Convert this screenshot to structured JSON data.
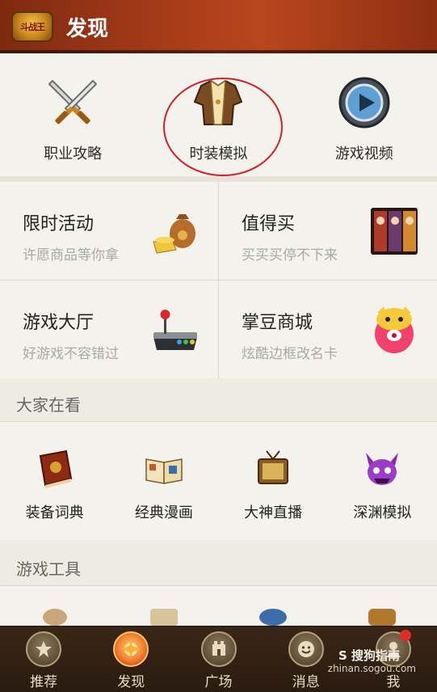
{
  "header": {
    "logo_text": "斗战王",
    "title": "发现"
  },
  "top_row": [
    {
      "label": "职业攻略",
      "icon": "crossed-swords-icon"
    },
    {
      "label": "时装模拟",
      "icon": "costume-icon"
    },
    {
      "label": "游戏视频",
      "icon": "play-icon"
    }
  ],
  "cards": [
    {
      "title": "限时活动",
      "sub": "许愿商品等你拿",
      "icon": "treasure-bag-icon"
    },
    {
      "title": "值得买",
      "sub": "买买买停不下来",
      "icon": "poster-icon"
    },
    {
      "title": "游戏大厅",
      "sub": "好游戏不容错过",
      "icon": "joystick-icon"
    },
    {
      "title": "掌豆商城",
      "sub": "炫酷边框改名卡",
      "icon": "mascot-icon"
    }
  ],
  "section1": {
    "title": "大家在看",
    "items": [
      {
        "label": "装备词典",
        "icon": "book-icon"
      },
      {
        "label": "经典漫画",
        "icon": "comic-icon"
      },
      {
        "label": "大神直播",
        "icon": "tv-icon"
      },
      {
        "label": "深渊模拟",
        "icon": "demon-icon"
      }
    ]
  },
  "section2": {
    "title": "游戏工具"
  },
  "bottom_nav": [
    {
      "label": "推荐",
      "icon": "recommend-icon"
    },
    {
      "label": "发现",
      "icon": "discover-icon"
    },
    {
      "label": "广场",
      "icon": "plaza-icon"
    },
    {
      "label": "消息",
      "icon": "message-icon"
    },
    {
      "label": "我",
      "icon": "profile-icon"
    }
  ],
  "watermark": {
    "brand": "S 搜狗指南",
    "url": "zhinan.sogou.com"
  },
  "colors": {
    "header": "#a33a18",
    "nav": "#2a1b10",
    "highlight": "#d0202a"
  }
}
